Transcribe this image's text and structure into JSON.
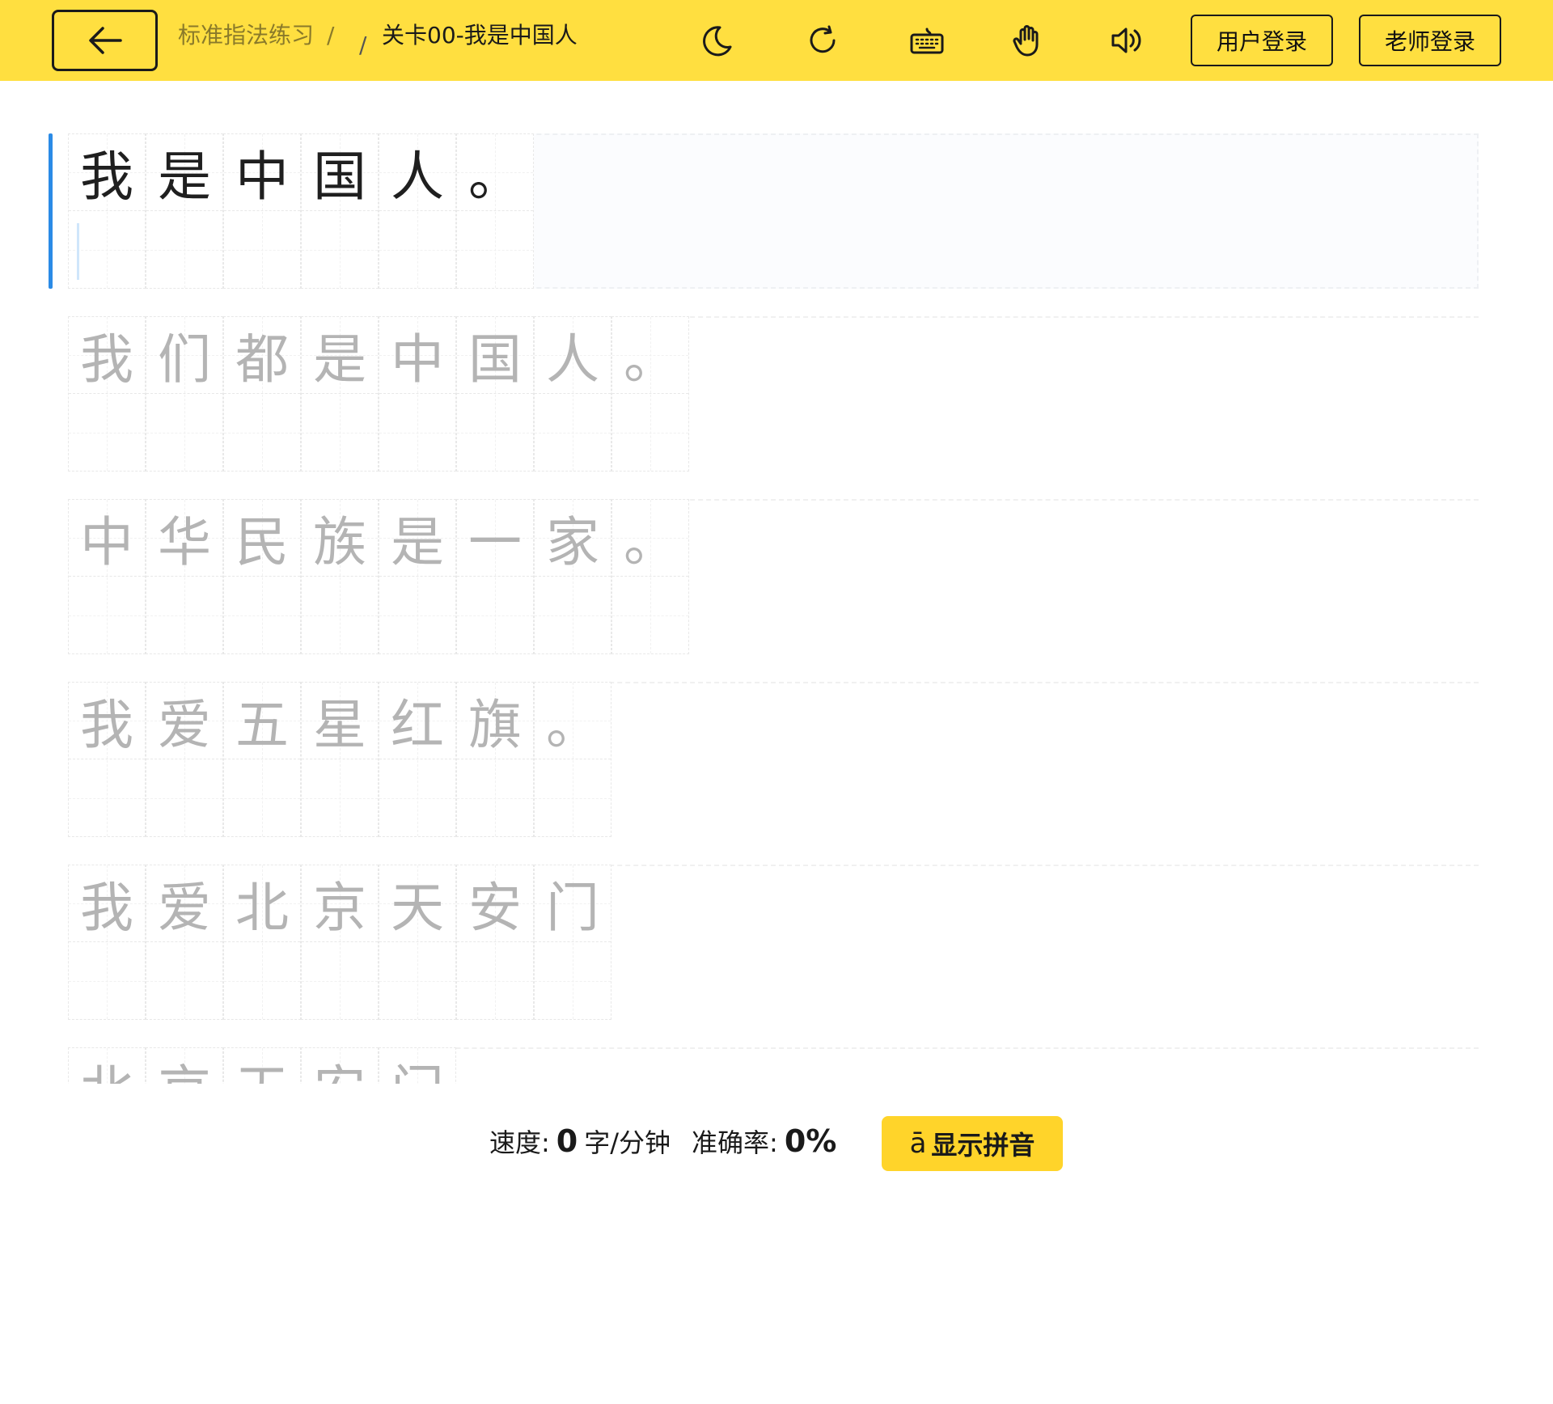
{
  "header": {
    "breadcrumb_parent": "标准指法练习",
    "breadcrumb_sep": "/",
    "breadcrumb_current": "关卡00-我是中国人",
    "user_login": "用户登录",
    "teacher_login": "老师登录",
    "icons": [
      "back-arrow-icon",
      "moon-icon",
      "refresh-icon",
      "keyboard-icon",
      "hand-icon",
      "speaker-icon"
    ]
  },
  "lines": [
    [
      "我",
      "是",
      "中",
      "国",
      "人",
      "。"
    ],
    [
      "我",
      "们",
      "都",
      "是",
      "中",
      "国",
      "人",
      "。"
    ],
    [
      "中",
      "华",
      "民",
      "族",
      "是",
      "一",
      "家",
      "。"
    ],
    [
      "我",
      "爱",
      "五",
      "星",
      "红",
      "旗",
      "。"
    ],
    [
      "我",
      "爱",
      "北",
      "京",
      "天",
      "安",
      "门"
    ],
    [
      "北",
      "京",
      "天",
      "安",
      "门"
    ]
  ],
  "active_line": 0,
  "stats": {
    "speed_label": "速度:",
    "speed_value": "0",
    "speed_unit": "字/分钟",
    "accuracy_label": "准确率:",
    "accuracy_value": "0%"
  },
  "pinyin_button": {
    "icon_glyph": "ā",
    "label": "显示拼音"
  },
  "colors": {
    "header_bg": "#ffdf40",
    "accent_blue": "#2b8be6",
    "pinyin_button_bg": "#ffd42a"
  }
}
